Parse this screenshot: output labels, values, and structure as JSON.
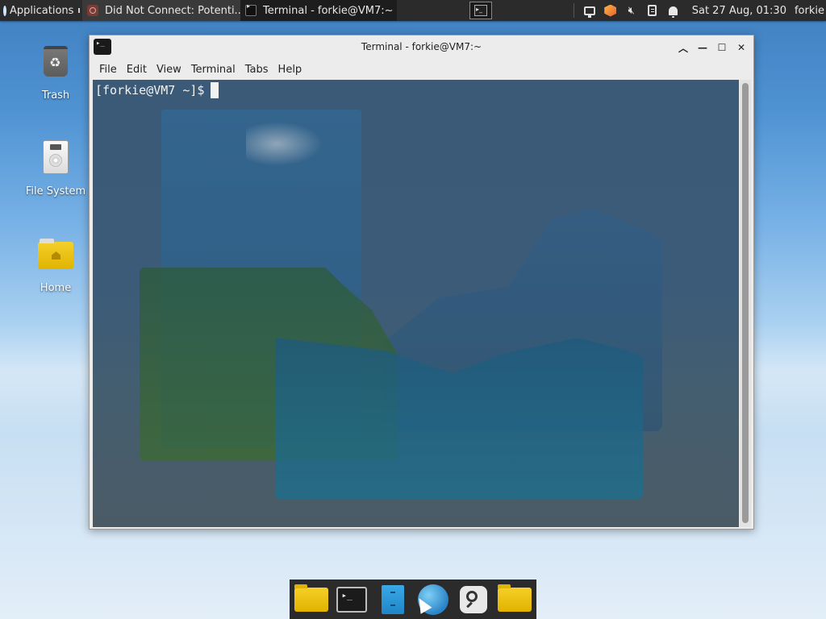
{
  "top_panel": {
    "applications_label": "Applications",
    "tasks": [
      {
        "label": "Did Not Connect: Potenti...",
        "icon": "firefox-icon",
        "active": false
      },
      {
        "label": "Terminal - forkie@VM7:~",
        "icon": "terminal-icon",
        "active": true
      }
    ],
    "workspace_icon": "workspace-switcher-icon",
    "tray_icons": [
      "display-icon",
      "package-updater-icon",
      "volume-muted-icon",
      "clipboard-icon",
      "notification-bell-icon"
    ],
    "clock": "Sat 27 Aug, 01:30",
    "user": "forkie"
  },
  "desktop": {
    "icons": [
      {
        "label": "Trash",
        "icon": "trash-icon"
      },
      {
        "label": "File System",
        "icon": "file-system-icon"
      },
      {
        "label": "Home",
        "icon": "home-folder-icon"
      }
    ]
  },
  "terminal_window": {
    "title": "Terminal - forkie@VM7:~",
    "menu": [
      "File",
      "Edit",
      "View",
      "Terminal",
      "Tabs",
      "Help"
    ],
    "prompt": "[forkie@VM7 ~]$",
    "controls": [
      "shade-up-icon",
      "minimize-icon",
      "maximize-icon",
      "close-icon"
    ]
  },
  "dock": {
    "items": [
      "file-manager-icon",
      "terminal-icon",
      "file-cabinet-icon",
      "web-browser-icon",
      "app-finder-icon",
      "folder-icon"
    ]
  },
  "colors": {
    "panel_bg": "#2b2b2b",
    "terminal_bg": "#3a5a78",
    "window_chrome": "#ececec"
  }
}
